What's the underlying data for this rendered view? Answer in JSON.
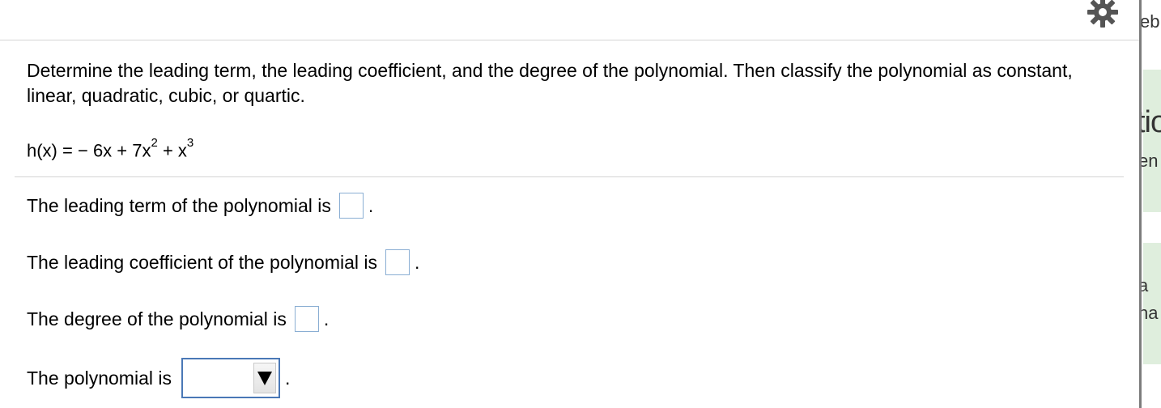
{
  "question": {
    "text": "Determine the leading term, the leading coefficient, and the degree of the polynomial. Then classify the polynomial as constant, linear, quadratic, cubic, or quartic."
  },
  "equation": {
    "lhs": "h(x) =",
    "term1": "− 6x + 7x",
    "exp1": "2",
    "term2": " + x",
    "exp2": "3"
  },
  "rows": {
    "leading_term": {
      "label": "The leading term of the polynomial is",
      "value": "",
      "suffix": "."
    },
    "leading_coefficient": {
      "label": "The leading coefficient of the polynomial is",
      "value": "",
      "suffix": "."
    },
    "degree": {
      "label": "The degree of the polynomial is",
      "value": "",
      "suffix": "."
    },
    "classification": {
      "label": "The polynomial is",
      "selected": "",
      "suffix": "."
    }
  },
  "side_panel": {
    "t1": "eb",
    "t2": "tio",
    "t3": "en",
    "t4": "a",
    "t5": "na"
  },
  "icons": {
    "settings": "gear-icon",
    "dropdown": "triangle-down-icon"
  },
  "colors": {
    "input_border": "#8aaed3",
    "select_border": "#4a78b6",
    "side_green": "#dfeedd"
  }
}
